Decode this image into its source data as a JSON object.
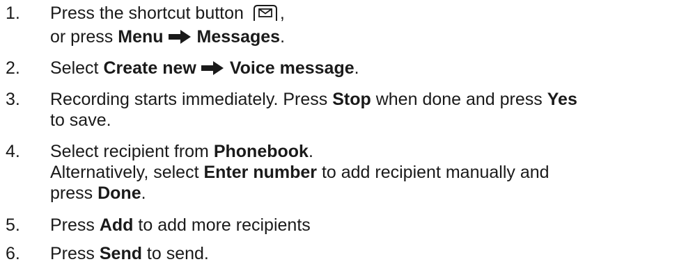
{
  "steps": [
    {
      "number": "1.",
      "line1_pre": "Press the shortcut button ",
      "line1_icon": "envelope-key-icon",
      "line1_post": ",",
      "line2_pre": "or press ",
      "line2_b1": "Menu",
      "line2_arrow": "right-arrow-icon",
      "line2_b2": "Messages",
      "line2_post": "."
    },
    {
      "number": "2.",
      "pre": "Select ",
      "b1": "Create new",
      "arrow": "right-arrow-icon",
      "b2": "Voice message",
      "post": "."
    },
    {
      "number": "3.",
      "pre": "Recording starts immediately. Press ",
      "b1": "Stop",
      "mid": " when done and press ",
      "b2": "Yes",
      "line2": "to save."
    },
    {
      "number": "4.",
      "line1_pre": "Select recipient from ",
      "line1_b": "Phonebook",
      "line1_post": ".",
      "line2_pre": "Alternatively, select ",
      "line2_b": "Enter number",
      "line2_post": " to add recipient manually and",
      "line3_pre": "press ",
      "line3_b": "Done",
      "line3_post": "."
    },
    {
      "number": "5.",
      "pre": "Press ",
      "b": "Add",
      "post": " to add more recipients"
    },
    {
      "number": "6.",
      "pre": "Press ",
      "b": "Send",
      "post": " to send."
    }
  ]
}
